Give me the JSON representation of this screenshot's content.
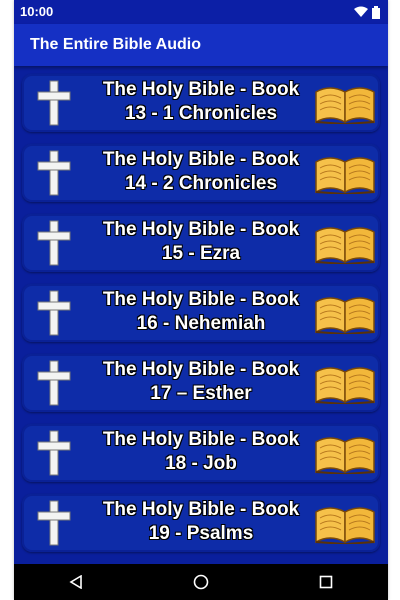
{
  "status": {
    "time": "10:00"
  },
  "app": {
    "title": "The Entire Bible Audio"
  },
  "items": [
    {
      "line1": "The Holy Bible - Book",
      "line2": "13 - 1 Chronicles"
    },
    {
      "line1": "The Holy Bible - Book",
      "line2": "14 - 2 Chronicles"
    },
    {
      "line1": "The Holy Bible - Book",
      "line2": "15 - Ezra"
    },
    {
      "line1": "The Holy Bible - Book",
      "line2": "16 - Nehemiah"
    },
    {
      "line1": "The Holy Bible - Book",
      "line2": "17 – Esther"
    },
    {
      "line1": "The Holy Bible - Book",
      "line2": "18 - Job"
    },
    {
      "line1": "The Holy Bible - Book",
      "line2": "19 - Psalms"
    }
  ],
  "icons": {
    "list_left": "cross-icon",
    "list_right": "open-book-icon",
    "nav": [
      "back-icon",
      "home-icon",
      "recents-icon"
    ]
  },
  "colors": {
    "background": "#0a1f9c",
    "app_bar": "#1530c4",
    "card": "#0e2ca8"
  }
}
